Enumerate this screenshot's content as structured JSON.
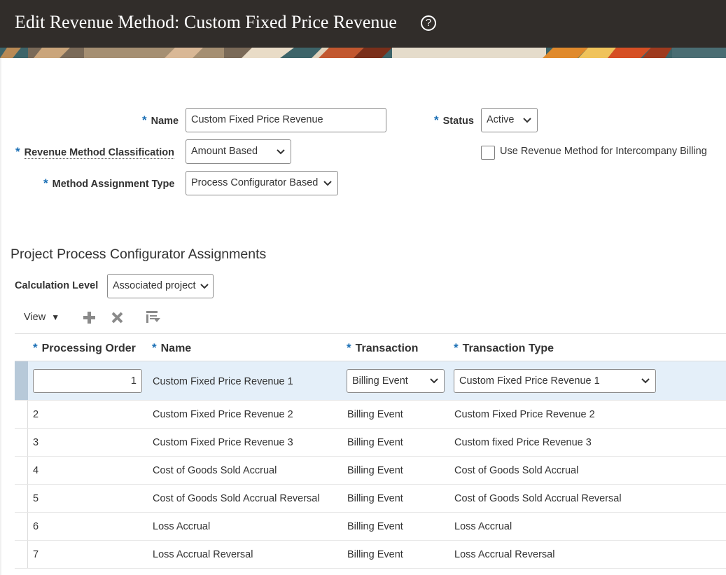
{
  "header": {
    "title": "Edit Revenue Method: Custom Fixed Price Revenue",
    "help_icon": "help-circle-icon",
    "help_glyph": "?"
  },
  "form": {
    "name_label": "Name",
    "name_value": "Custom Fixed Price Revenue",
    "status_label": "Status",
    "status_value": "Active",
    "classification_label": "Revenue Method Classification",
    "classification_value": "Amount Based",
    "intercompany_label": "Use Revenue Method for Intercompany Billing",
    "intercompany_checked": false,
    "assignment_type_label": "Method Assignment Type",
    "assignment_type_value": "Process Configurator Based",
    "required_marker": "*"
  },
  "section": {
    "title": "Project Process Configurator Assignments",
    "calc_level_label": "Calculation Level",
    "calc_level_value": "Associated project"
  },
  "toolbar": {
    "view_label": "View",
    "view_caret": "▼",
    "icons": [
      "add-icon",
      "delete-icon",
      "detach-icon"
    ]
  },
  "table": {
    "columns": [
      "Processing Order",
      "Name",
      "Transaction",
      "Transaction Type"
    ],
    "rows": [
      {
        "order": "1",
        "name": "Custom Fixed Price Revenue 1",
        "transaction": "Billing Event",
        "type": "Custom Fixed Price Revenue 1"
      },
      {
        "order": "2",
        "name": "Custom Fixed Price Revenue 2",
        "transaction": "Billing Event",
        "type": "Custom Fixed Price Revenue 2"
      },
      {
        "order": "3",
        "name": "Custom Fixed Price Revenue 3",
        "transaction": "Billing Event",
        "type": "Custom fixed Price Revenue 3"
      },
      {
        "order": "4",
        "name": "Cost of Goods Sold Accrual",
        "transaction": "Billing Event",
        "type": "Cost of Goods Sold Accrual"
      },
      {
        "order": "5",
        "name": "Cost of Goods Sold Accrual Reversal",
        "transaction": "Billing Event",
        "type": "Cost of Goods Sold Accrual Reversal"
      },
      {
        "order": "6",
        "name": "Loss Accrual",
        "transaction": "Billing Event",
        "type": "Loss Accrual"
      },
      {
        "order": "7",
        "name": "Loss Accrual Reversal",
        "transaction": "Billing Event",
        "type": "Loss Accrual Reversal"
      }
    ]
  },
  "colors": {
    "header_bg": "#312d2a",
    "required_marker": "#1a6fb5",
    "selected_row": "#e4eff9"
  }
}
